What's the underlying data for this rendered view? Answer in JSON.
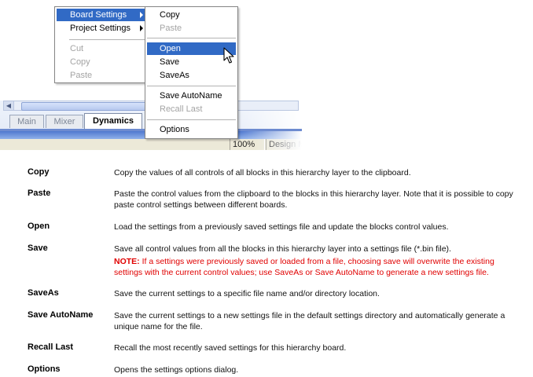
{
  "context_menu": {
    "items": [
      {
        "label": "Board Settings",
        "has_submenu": true,
        "selected": true,
        "disabled": false
      },
      {
        "label": "Project Settings",
        "has_submenu": true,
        "selected": false,
        "disabled": false
      },
      {
        "label": "Cut",
        "disabled": true
      },
      {
        "label": "Copy",
        "disabled": true
      },
      {
        "label": "Paste",
        "disabled": true
      }
    ]
  },
  "submenu": {
    "items": [
      {
        "label": "Copy",
        "disabled": false
      },
      {
        "label": "Paste",
        "disabled": true
      },
      {
        "label": "Open",
        "disabled": false,
        "selected": true
      },
      {
        "label": "Save",
        "disabled": false
      },
      {
        "label": "SaveAs",
        "disabled": false
      },
      {
        "label": "Save AutoName",
        "disabled": false
      },
      {
        "label": "Recall Last",
        "disabled": true
      },
      {
        "label": "Options",
        "disabled": false
      }
    ]
  },
  "tabs": [
    {
      "label": "Main",
      "active": false
    },
    {
      "label": "Mixer",
      "active": false
    },
    {
      "label": "Dynamics",
      "active": true
    }
  ],
  "statusbar": {
    "zoom": "100%",
    "mode": "Design M"
  },
  "doc_table": {
    "rows": [
      {
        "term": "Copy",
        "description": "Copy the values of all controls of all blocks in this hierarchy layer to the clipboard."
      },
      {
        "term": "Paste",
        "description": "Paste the control values from the clipboard to the blocks in this hierarchy layer. Note that it is possible to copy paste control settings between different boards."
      },
      {
        "term": "Open",
        "description": "Load the settings from a previously saved settings file and update the blocks control values."
      },
      {
        "term": "Save",
        "description": "Save all control values from all the blocks in this hierarchy layer into a settings file (*.bin file).",
        "note_label": "NOTE:",
        "note": " If a settings were previously saved or loaded from a file, choosing save will overwrite the existing settings with the current control values; use SaveAs or Save AutoName to generate a new settings file."
      },
      {
        "term": "SaveAs",
        "description": "Save the current settings to a specific file name and/or directory location."
      },
      {
        "term": "Save AutoName",
        "description": "Save the current settings to a new settings file in the default settings directory and automatically generate a unique name for the file."
      },
      {
        "term": "Recall Last",
        "description": "Recall the most recently saved settings for this hierarchy board."
      },
      {
        "term": "Options",
        "description": "Opens the settings options dialog."
      }
    ]
  },
  "colors": {
    "menu_highlight": "#316ac5",
    "note_text": "#e00000",
    "disabled_text": "#a4a4a4"
  }
}
